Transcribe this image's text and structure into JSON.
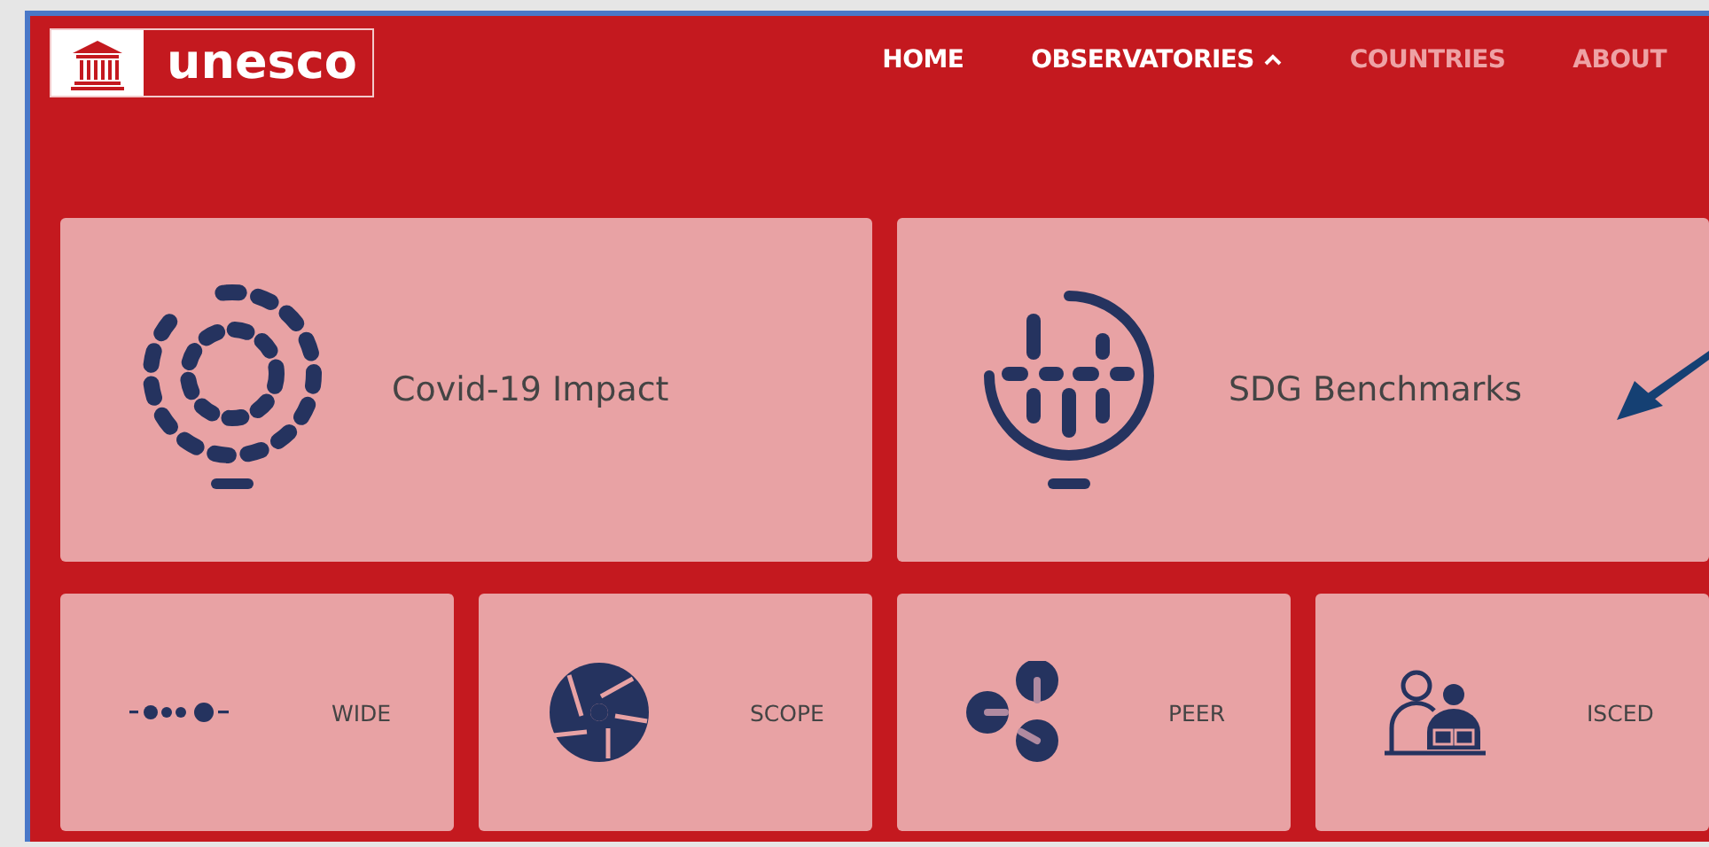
{
  "logo": {
    "text": "unesco"
  },
  "nav": [
    {
      "label": "HOME",
      "kind": "link",
      "highlighted": true
    },
    {
      "label": "OBSERVATORIES",
      "kind": "dropdown",
      "highlighted": true,
      "expanded": true
    },
    {
      "label": "COUNTRIES",
      "kind": "link",
      "highlighted": false
    },
    {
      "label": "ABOUT",
      "kind": "link",
      "highlighted": false
    }
  ],
  "cards": [
    {
      "label": "Covid-19 Impact"
    },
    {
      "label": "SDG Benchmarks"
    },
    {
      "label": "WIDE"
    },
    {
      "label": "SCOPE"
    },
    {
      "label": "PEER"
    },
    {
      "label": "ISCED"
    }
  ]
}
